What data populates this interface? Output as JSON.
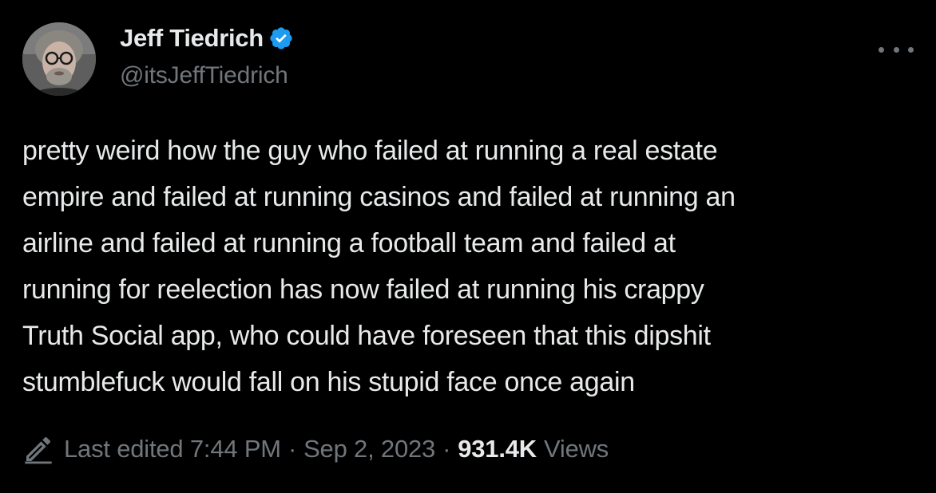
{
  "author": {
    "display_name": "Jeff Tiedrich",
    "handle": "@itsJeffTiedrich",
    "verified": true,
    "verified_color": "#1d9bf0"
  },
  "tweet": {
    "lines": [
      "pretty weird how the guy who failed at running a real estate",
      "empire and failed at running casinos and failed at running an",
      "airline and failed at running a football team and failed at",
      "running for reelection has now failed at running his crappy",
      "Truth Social app, who could have foreseen that this dipshit",
      "stumblefuck would fall on his stupid face once again"
    ]
  },
  "meta": {
    "edited_label": "Last edited 7:44 PM",
    "separator": "·",
    "date": "Sep 2, 2023",
    "views_count": "931.4K",
    "views_label": "Views"
  },
  "icons": {
    "more": "more-horizontal-icon",
    "edit": "pencil-icon",
    "verified": "verified-badge-icon"
  },
  "colors": {
    "background": "#000000",
    "primary_text": "#e7e9ea",
    "secondary_text": "#71767b"
  }
}
